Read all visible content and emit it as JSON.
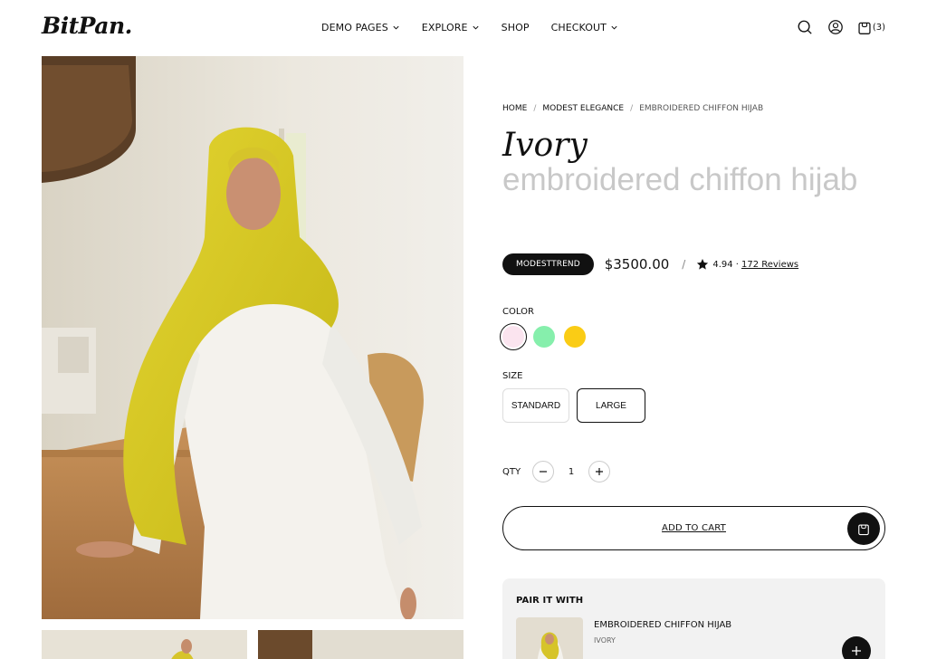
{
  "header": {
    "logo": "BitPan.",
    "nav": [
      {
        "label": "DEMO PAGES",
        "has_dropdown": true
      },
      {
        "label": "EXPLORE",
        "has_dropdown": true
      },
      {
        "label": "SHOP",
        "has_dropdown": false
      },
      {
        "label": "CHECKOUT",
        "has_dropdown": true
      }
    ],
    "icons": [
      "search-icon",
      "user-icon",
      "bag-icon"
    ],
    "cart_count": "(3)"
  },
  "gallery": {
    "main_image": "woman-wearing-yellow-hijab-white-dress",
    "thumbnails": [
      "hijab-thumbnail-1",
      "hijab-thumbnail-2"
    ]
  },
  "product": {
    "breadcrumb": [
      "HOME",
      "MODEST ELEGANCE",
      "EMBROIDERED CHIFFON HIJAB"
    ],
    "title_primary": "Ivory",
    "title_secondary": "embroidered chiffon hijab",
    "brand_badge": "MODESTTREND",
    "price": "$3500.00",
    "separator": "/",
    "rating": "4.94 ·",
    "reviews": "172 Reviews",
    "color_label": "COLOR",
    "colors": [
      {
        "name": "pink",
        "hex": "#fbe4ef",
        "selected": true
      },
      {
        "name": "green",
        "hex": "#86efac",
        "selected": false
      },
      {
        "name": "yellow",
        "hex": "#facc15",
        "selected": false
      }
    ],
    "size_label": "SIZE",
    "sizes": [
      {
        "label": "STANDARD",
        "selected": false
      },
      {
        "label": "LARGE",
        "selected": true
      }
    ],
    "qty_label": "QTY",
    "qty_value": "1",
    "add_to_cart": "ADD TO CART"
  },
  "pair_it_with": {
    "title": "PAIR IT WITH",
    "item_name": "EMBROIDERED CHIFFON HIJAB",
    "item_variant": "IVORY"
  },
  "colors": {
    "accent": "#111111",
    "muted_title": "#c8c8c8",
    "panel_bg": "#f2f2f2"
  }
}
